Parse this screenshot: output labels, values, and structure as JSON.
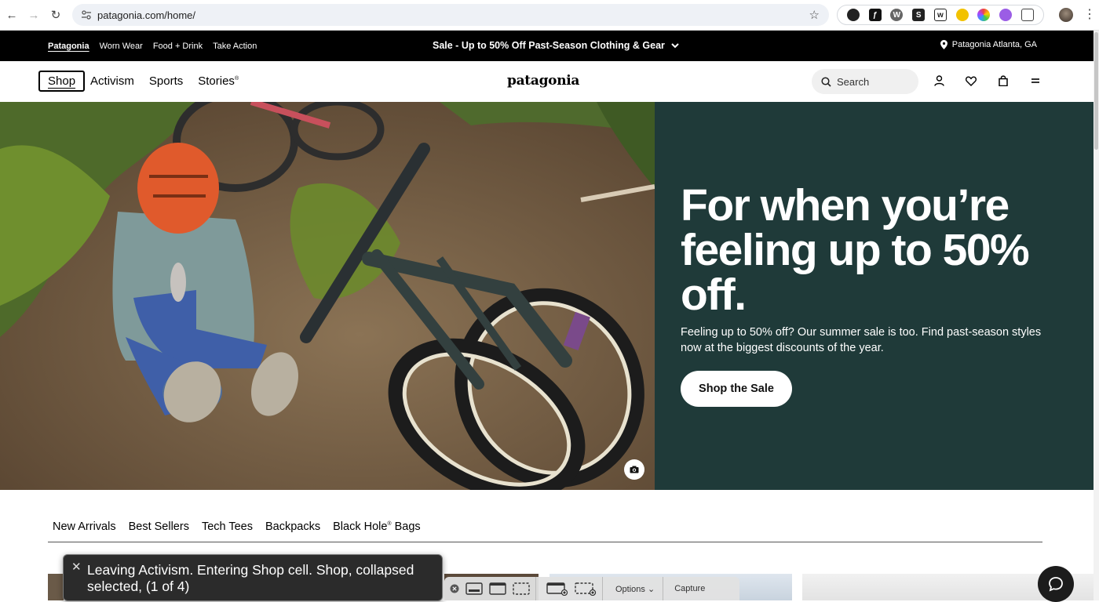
{
  "browser": {
    "url": "patagonia.com/home/"
  },
  "promo_bar": {
    "links": [
      "Patagonia",
      "Worn Wear",
      "Food + Drink",
      "Take Action"
    ],
    "sale_text": "Sale - Up to 50% Off Past-Season Clothing & Gear",
    "location": "Patagonia Atlanta, GA"
  },
  "header": {
    "nav": [
      "Shop",
      "Activism",
      "Sports",
      "Stories"
    ],
    "stories_mark": "®",
    "logo": "patagonia",
    "search_placeholder": "Search"
  },
  "hero": {
    "title": "For when you’re feeling up to 50% off.",
    "subtitle": "Feeling up to 50% off? Our summer sale is too. Find past-season styles now at the biggest discounts of the year.",
    "cta": "Shop the Sale",
    "panel_color": "#1f3a39"
  },
  "categories": {
    "items": [
      "New Arrivals",
      "Best Sellers",
      "Tech Tees",
      "Backpacks"
    ],
    "last_item_name": "Black Hole",
    "last_item_mark": "®",
    "last_item_suffix": " Bags"
  },
  "voiceover": {
    "caption": "Leaving Activism. Entering Shop cell. Shop, collapsed selected, (1 of 4)"
  },
  "capture_toolbar": {
    "options": "Options",
    "options_arrow": "⌄",
    "capture": "Capture"
  }
}
